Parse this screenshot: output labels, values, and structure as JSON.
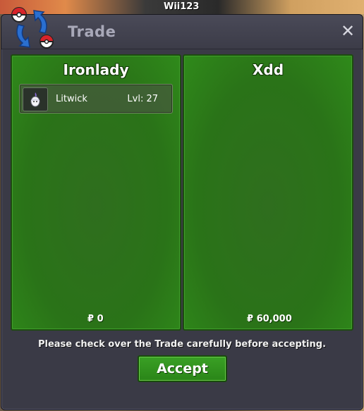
{
  "game_overlay": {
    "player_name_tag": "Wii123"
  },
  "window": {
    "title": "Trade",
    "close_icon": "close-icon",
    "title_icon": "trade-swap-icon"
  },
  "trade": {
    "left": {
      "trainer": "Ironlady",
      "pokemon": [
        {
          "name": "Litwick",
          "level": "Lvl: 27",
          "icon": "litwick-icon"
        }
      ],
      "money": "₽ 0"
    },
    "right": {
      "trainer": "Xdd",
      "pokemon": [],
      "money": "₽ 60,000"
    }
  },
  "notice": "Please check over the Trade carefully before accepting.",
  "accept_label": "Accept",
  "colors": {
    "panel_green": "#2a7318",
    "window_bg": "#3a3a46",
    "accept_green": "#3aa025"
  }
}
